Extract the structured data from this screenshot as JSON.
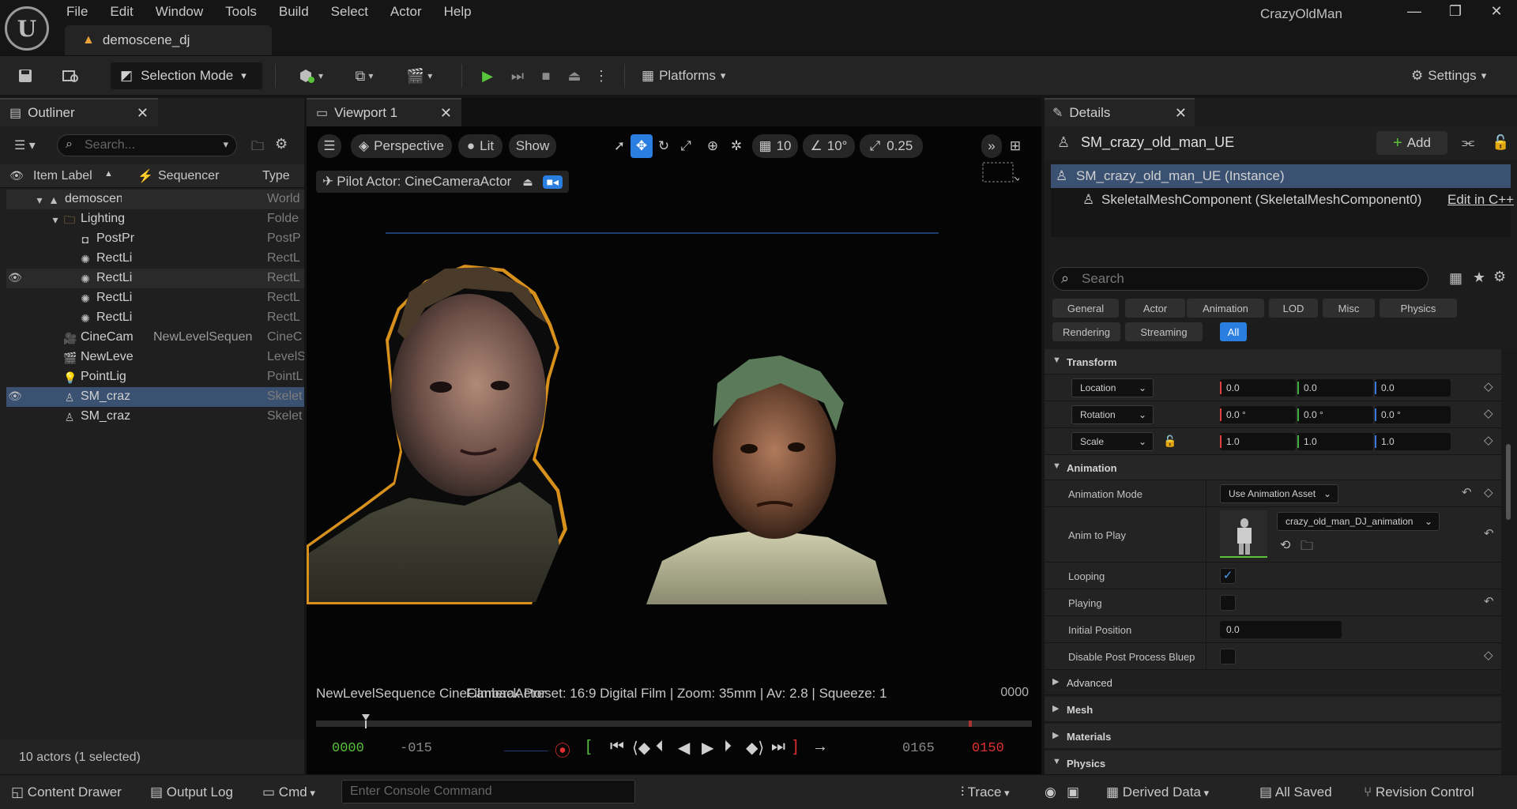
{
  "app": {
    "project_name": "CrazyOldMan",
    "logo_text": "U"
  },
  "menu": [
    "File",
    "Edit",
    "Window",
    "Tools",
    "Build",
    "Select",
    "Actor",
    "Help"
  ],
  "document_tab": {
    "label": "demoscene_dj"
  },
  "toolbar": {
    "selection_mode": "Selection Mode",
    "platforms": "Platforms",
    "settings": "Settings"
  },
  "outliner": {
    "tab_label": "Outliner",
    "search_placeholder": "Search...",
    "columns": {
      "item_label": "Item Label",
      "sequencer": "Sequencer",
      "type": "Type"
    },
    "rows": [
      {
        "label": "demoscen",
        "sequencer": "",
        "type": "World",
        "indent": 0,
        "icon": "level-icon",
        "eye": false,
        "state": "hl"
      },
      {
        "label": "Lighting",
        "sequencer": "",
        "type": "Folde",
        "indent": 1,
        "icon": "folder-icon",
        "eye": false,
        "state": ""
      },
      {
        "label": "PostPr",
        "sequencer": "",
        "type": "PostP",
        "indent": 2,
        "icon": "postprocess-icon",
        "eye": false,
        "state": ""
      },
      {
        "label": "RectLi",
        "sequencer": "",
        "type": "RectL",
        "indent": 2,
        "icon": "light-icon",
        "eye": false,
        "state": ""
      },
      {
        "label": "RectLi",
        "sequencer": "",
        "type": "RectL",
        "indent": 2,
        "icon": "light-icon",
        "eye": true,
        "state": "hl"
      },
      {
        "label": "RectLi",
        "sequencer": "",
        "type": "RectL",
        "indent": 2,
        "icon": "light-icon",
        "eye": false,
        "state": ""
      },
      {
        "label": "RectLi",
        "sequencer": "",
        "type": "RectL",
        "indent": 2,
        "icon": "light-icon",
        "eye": false,
        "state": ""
      },
      {
        "label": "CineCam",
        "sequencer": "NewLevelSequen",
        "type": "CineC",
        "indent": 1,
        "icon": "camera-icon",
        "eye": false,
        "state": ""
      },
      {
        "label": "NewLeve",
        "sequencer": "",
        "type": "LevelS",
        "indent": 1,
        "icon": "clapper-icon",
        "eye": false,
        "state": ""
      },
      {
        "label": "PointLig",
        "sequencer": "",
        "type": "PointL",
        "indent": 1,
        "icon": "bulb-icon",
        "eye": false,
        "state": ""
      },
      {
        "label": "SM_craz",
        "sequencer": "",
        "type": "Skelet",
        "indent": 1,
        "icon": "skeleton-icon",
        "eye": true,
        "state": "sel"
      },
      {
        "label": "SM_craz",
        "sequencer": "",
        "type": "Skelet",
        "indent": 1,
        "icon": "skeleton-icon",
        "eye": false,
        "state": ""
      }
    ],
    "status": "10 actors (1 selected)"
  },
  "viewport": {
    "tab_label": "Viewport 1",
    "perspective": "Perspective",
    "lit": "Lit",
    "show": "Show",
    "grid_value": "10",
    "angle_value": "10°",
    "scale_value": "0.25",
    "pilot_label": "Pilot Actor: CineCameraActor",
    "overlay_left": "NewLevelSequence  CineCameraActor",
    "overlay_right": "Filmback Preset: 16:9 Digital Film | Zoom: 35mm | Av: 2.8 | Squeeze: 1",
    "frame_counter": "0000",
    "timecodes": {
      "start": "0000",
      "offset": "-015",
      "end_in": "0165",
      "end_out": "0150"
    }
  },
  "details": {
    "tab_label": "Details",
    "object_name": "SM_crazy_old_man_UE",
    "add_label": "Add",
    "components": [
      {
        "label": "SM_crazy_old_man_UE (Instance)",
        "selected": true
      },
      {
        "label": "SkeletalMeshComponent (SkeletalMeshComponent0)",
        "selected": false
      }
    ],
    "edit_cpp": "Edit in C++",
    "search_placeholder": "Search",
    "filters_row1": [
      "General",
      "Actor",
      "Animation",
      "LOD",
      "Misc",
      "Physics"
    ],
    "filters_row2": [
      "Rendering",
      "Streaming",
      "All"
    ],
    "active_filter": "All",
    "transform": {
      "title": "Transform",
      "location": {
        "label": "Location",
        "x": "0.0",
        "y": "0.0",
        "z": "0.0"
      },
      "rotation": {
        "label": "Rotation",
        "x": "0.0 °",
        "y": "0.0 °",
        "z": "0.0 °"
      },
      "scale": {
        "label": "Scale",
        "x": "1.0",
        "y": "1.0",
        "z": "1.0"
      }
    },
    "animation": {
      "title": "Animation",
      "mode_label": "Animation Mode",
      "mode_value": "Use Animation Asset",
      "anim_label": "Anim to Play",
      "anim_value": "crazy_old_man_DJ_animation",
      "looping_label": "Looping",
      "looping": true,
      "playing_label": "Playing",
      "playing": false,
      "initial_position_label": "Initial Position",
      "initial_position": "0.0",
      "disable_pp_label": "Disable Post Process Bluep...",
      "disable_pp": false
    },
    "collapsed_sections": [
      "Advanced",
      "Mesh",
      "Materials",
      "Physics"
    ]
  },
  "statusbar": {
    "content_drawer": "Content Drawer",
    "output_log": "Output Log",
    "cmd": "Cmd",
    "console_placeholder": "Enter Console Command",
    "trace": "Trace",
    "derived_data": "Derived Data",
    "all_saved": "All Saved",
    "revision_control": "Revision Control"
  },
  "colors": {
    "selection": "#3a5172",
    "accent_blue": "#2a7ee0",
    "play_green": "#58c33b",
    "highlight_orange": "#f0a020",
    "x_axis": "#e04040",
    "y_axis": "#40b040",
    "z_axis": "#3a7ae0"
  }
}
